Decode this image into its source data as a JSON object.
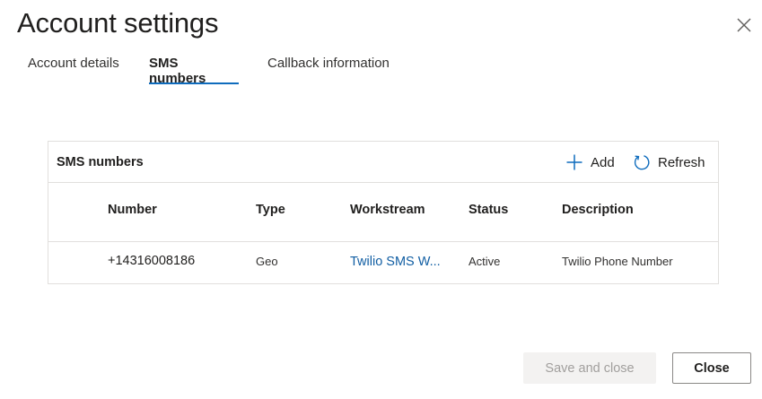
{
  "dialog": {
    "title": "Account settings",
    "close_icon": "close-icon"
  },
  "tabs": [
    {
      "label": "Account details",
      "active": false
    },
    {
      "label": "SMS numbers",
      "active": true
    },
    {
      "label": "Callback information",
      "active": false
    }
  ],
  "grid": {
    "title": "SMS numbers",
    "commands": {
      "add_label": "Add",
      "add_icon": "plus-icon",
      "refresh_label": "Refresh",
      "refresh_icon": "refresh-icon"
    },
    "columns": [
      "Number",
      "Type",
      "Workstream",
      "Status",
      "Description"
    ],
    "rows": [
      {
        "number": "+14316008186",
        "type": "Geo",
        "workstream": "Twilio SMS Workstream",
        "workstream_display": "Twilio SMS W...",
        "status": "Active",
        "description": "Twilio Phone Number"
      }
    ]
  },
  "footer": {
    "save_label": "Save and close",
    "save_enabled": false,
    "close_label": "Close"
  },
  "colors": {
    "accent": "#0f6cbd",
    "link": "#115ea3",
    "border": "#e1dfdd",
    "disabled_bg": "#f3f2f1"
  }
}
